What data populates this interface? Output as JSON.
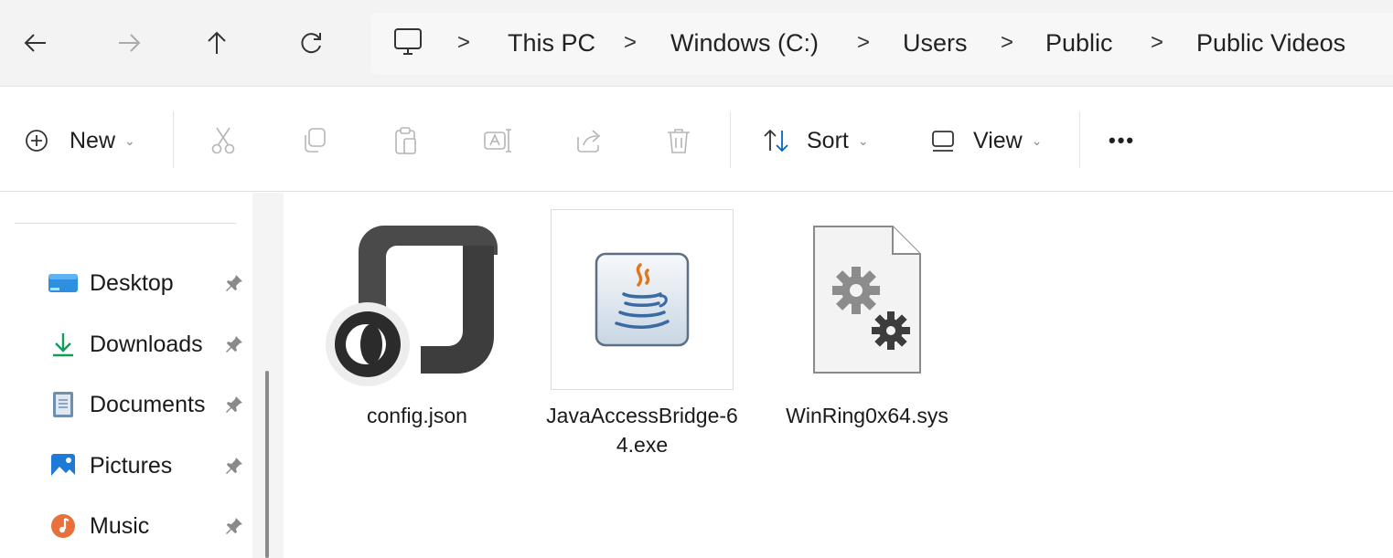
{
  "navigation": {
    "back_icon": "back-arrow-icon",
    "forward_icon": "forward-arrow-icon",
    "up_icon": "up-arrow-icon",
    "refresh_icon": "refresh-icon"
  },
  "breadcrumb": {
    "root_icon": "this-pc-icon",
    "items": [
      "This PC",
      "Windows (C:)",
      "Users",
      "Public",
      "Public Videos"
    ],
    "separator": ">"
  },
  "toolbar": {
    "new_label": "New",
    "sort_label": "Sort",
    "view_label": "View",
    "more_label": "•••",
    "icons": [
      "cut-icon",
      "copy-icon",
      "paste-icon",
      "rename-icon",
      "share-icon",
      "delete-icon"
    ]
  },
  "sidebar": {
    "items": [
      {
        "label": "Desktop",
        "icon": "desktop-icon",
        "pinned": true
      },
      {
        "label": "Downloads",
        "icon": "download-icon",
        "pinned": true
      },
      {
        "label": "Documents",
        "icon": "documents-icon",
        "pinned": true
      },
      {
        "label": "Pictures",
        "icon": "pictures-icon",
        "pinned": true
      },
      {
        "label": "Music",
        "icon": "music-icon",
        "pinned": true
      }
    ]
  },
  "files": [
    {
      "name": "config.json",
      "icon": "json-file-icon"
    },
    {
      "name": "JavaAccessBridge-64.exe",
      "icon": "java-exe-icon",
      "selected": true
    },
    {
      "name": "WinRing0x64.sys",
      "icon": "system-file-icon"
    }
  ],
  "colors": {
    "accent": "#0067c0",
    "download_green": "#0f9d58",
    "music_orange": "#e8703a"
  }
}
